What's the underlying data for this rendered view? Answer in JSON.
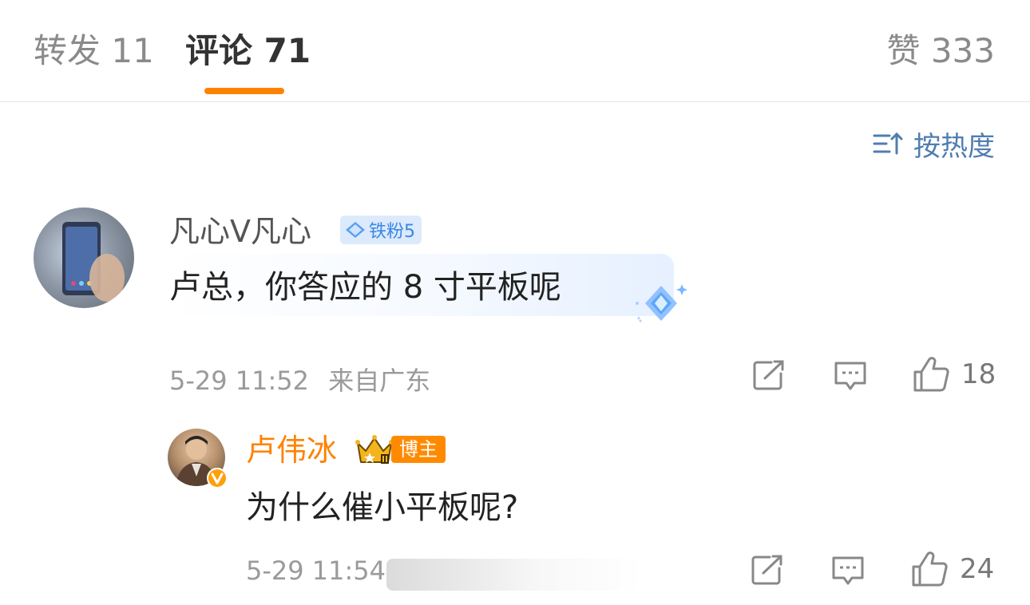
{
  "tabs": {
    "repost": "转发 11",
    "comment": "评论 71",
    "likes": "赞 333"
  },
  "sort": {
    "label": "按热度",
    "icon": "sort-icon"
  },
  "comments": [
    {
      "username": "凡心Ⅴ凡心",
      "fan_badge": "铁粉5",
      "text": "卢总，你答应的 8 寸平板呢",
      "time": "5-29 11:52",
      "location": "来自广东",
      "like_count": "18"
    }
  ],
  "reply": {
    "username": "卢伟冰",
    "host_badge": "博主",
    "text": "为什么催小平板呢?",
    "time": "5-29 11:54",
    "like_count": "24"
  },
  "colors": {
    "accent": "#ff8200",
    "link_blue": "#507daf",
    "meta_gray": "#9a9a9a"
  },
  "icons": [
    "share-icon",
    "comment-icon",
    "like-icon",
    "diamond-icon",
    "crown-icon",
    "verified-icon"
  ]
}
